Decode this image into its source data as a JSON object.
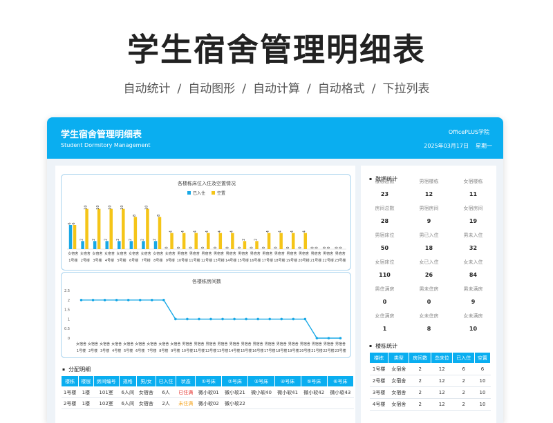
{
  "hero": {
    "title": "学生宿舍管理明细表",
    "features": [
      "自动统计",
      "自动图形",
      "自动计算",
      "自动格式",
      "下拉列表"
    ],
    "separator": "/"
  },
  "header": {
    "title": "学生宿舍管理明细表",
    "subtitle": "Student Dormitory Management",
    "brand": "OfficePLUS学院",
    "date": "2025年03月17日",
    "weekday": "星期一"
  },
  "colors": {
    "accent": "#0aaef0",
    "series_occupied": "#18a8e6",
    "series_vacant": "#f5c518"
  },
  "chart_data": [
    {
      "type": "bar",
      "title": "各楼栋床位入住及空置情况",
      "legend": [
        "已入住",
        "空置"
      ],
      "legend_position": "top-center",
      "categories": [
        "1号楼",
        "2号楼",
        "3号楼",
        "4号楼",
        "5号楼",
        "6号楼",
        "7号楼",
        "8号楼",
        "9号楼",
        "10号楼",
        "11号楼",
        "12号楼",
        "13号楼",
        "14号楼",
        "15号楼",
        "16号楼",
        "17号楼",
        "18号楼",
        "19号楼",
        "20号楼",
        "21号楼",
        "22号楼",
        "23号楼"
      ],
      "category_types": [
        "女宿舍",
        "女宿舍",
        "女宿舍",
        "女宿舍",
        "女宿舍",
        "女宿舍",
        "女宿舍",
        "女宿舍",
        "女宿舍",
        "男宿舍",
        "男宿舍",
        "男宿舍",
        "男宿舍",
        "男宿舍",
        "男宿舍",
        "男宿舍",
        "男宿舍",
        "男宿舍",
        "男宿舍",
        "男宿舍",
        "男宿舍",
        "男宿舍",
        "男宿舍"
      ],
      "series": [
        {
          "name": "已入住",
          "values": [
            6,
            2,
            2,
            2,
            2,
            2,
            2,
            2,
            0,
            0,
            0,
            0,
            0,
            0,
            0,
            0,
            0,
            0,
            0,
            0,
            0,
            0,
            0
          ]
        },
        {
          "name": "空置",
          "values": [
            6,
            10,
            10,
            10,
            10,
            8,
            10,
            8,
            4,
            4,
            4,
            4,
            4,
            4,
            2,
            2,
            4,
            4,
            4,
            4,
            0,
            0,
            0
          ]
        }
      ],
      "ylim": [
        0,
        12
      ]
    },
    {
      "type": "line",
      "title": "各楼栋房间数",
      "categories": [
        "1号楼",
        "2号楼",
        "3号楼",
        "4号楼",
        "5号楼",
        "6号楼",
        "7号楼",
        "8号楼",
        "9号楼",
        "10号楼",
        "11号楼",
        "12号楼",
        "13号楼",
        "14号楼",
        "15号楼",
        "16号楼",
        "17号楼",
        "18号楼",
        "19号楼",
        "20号楼",
        "21号楼",
        "22号楼",
        "23号楼"
      ],
      "category_types": [
        "女宿舍",
        "女宿舍",
        "女宿舍",
        "女宿舍",
        "女宿舍",
        "女宿舍",
        "女宿舍",
        "女宿舍",
        "女宿舍",
        "男宿舍",
        "男宿舍",
        "男宿舍",
        "男宿舍",
        "男宿舍",
        "男宿舍",
        "男宿舍",
        "男宿舍",
        "男宿舍",
        "男宿舍",
        "男宿舍",
        "男宿舍",
        "男宿舍",
        "男宿舍"
      ],
      "values": [
        2,
        2,
        2,
        2,
        2,
        2,
        2,
        2,
        1,
        1,
        1,
        1,
        1,
        1,
        1,
        1,
        1,
        1,
        1,
        1,
        0,
        0,
        0
      ],
      "yticks": [
        "0",
        "0.5",
        "1",
        "1.5",
        "2",
        "2.5"
      ],
      "ylim": [
        0,
        2.5
      ]
    }
  ],
  "allocation": {
    "title": "分配明细",
    "headers": [
      "楼栋",
      "楼层",
      "房间编号",
      "规格",
      "男/女",
      "已入住",
      "状态",
      "①号床",
      "②号床",
      "③号床",
      "④号床",
      "⑤号床",
      "⑥号床"
    ],
    "rows": [
      [
        "1号楼",
        "1楼",
        "101室",
        "6人间",
        "女宿舍",
        "6人",
        "已住满",
        "微小软01",
        "微小软21",
        "微小软40",
        "微小软41",
        "微小软42",
        "微小软43"
      ],
      [
        "2号楼",
        "1楼",
        "102室",
        "6人间",
        "女宿舍",
        "2人",
        "未住满",
        "微小软02",
        "微小软22",
        "",
        "",
        "",
        ""
      ]
    ],
    "status_colors": {
      "已住满": "#e53935",
      "未住满": "#f5a623"
    }
  },
  "stats": {
    "title": "数据统计",
    "items": [
      {
        "label": "楼栋总数",
        "value": "23"
      },
      {
        "label": "男宿楼栋",
        "value": "12"
      },
      {
        "label": "女宿楼栋",
        "value": "11"
      },
      {
        "label": "房间总数",
        "value": "28"
      },
      {
        "label": "男宿房间",
        "value": "9"
      },
      {
        "label": "女宿房间",
        "value": "19"
      },
      {
        "label": "男宿床位",
        "value": "50"
      },
      {
        "label": "男已入住",
        "value": "18"
      },
      {
        "label": "男未入住",
        "value": "32"
      },
      {
        "label": "女宿床位",
        "value": "110"
      },
      {
        "label": "女已入住",
        "value": "26"
      },
      {
        "label": "女未入住",
        "value": "84"
      },
      {
        "label": "男住满房",
        "value": "0"
      },
      {
        "label": "男未住房",
        "value": "0"
      },
      {
        "label": "男未满房",
        "value": "9"
      },
      {
        "label": "女住满房",
        "value": "1"
      },
      {
        "label": "女未住房",
        "value": "8"
      },
      {
        "label": "女未满房",
        "value": "10"
      }
    ]
  },
  "building_stats": {
    "title": "楼栋统计",
    "headers": [
      "楼栋",
      "类型",
      "房间数",
      "总床位",
      "已入住",
      "空置"
    ],
    "rows": [
      [
        "1号楼",
        "女宿舍",
        "2",
        "12",
        "6",
        "6"
      ],
      [
        "2号楼",
        "女宿舍",
        "2",
        "12",
        "2",
        "10"
      ],
      [
        "3号楼",
        "女宿舍",
        "2",
        "12",
        "2",
        "10"
      ],
      [
        "4号楼",
        "女宿舍",
        "2",
        "12",
        "2",
        "10"
      ]
    ]
  }
}
